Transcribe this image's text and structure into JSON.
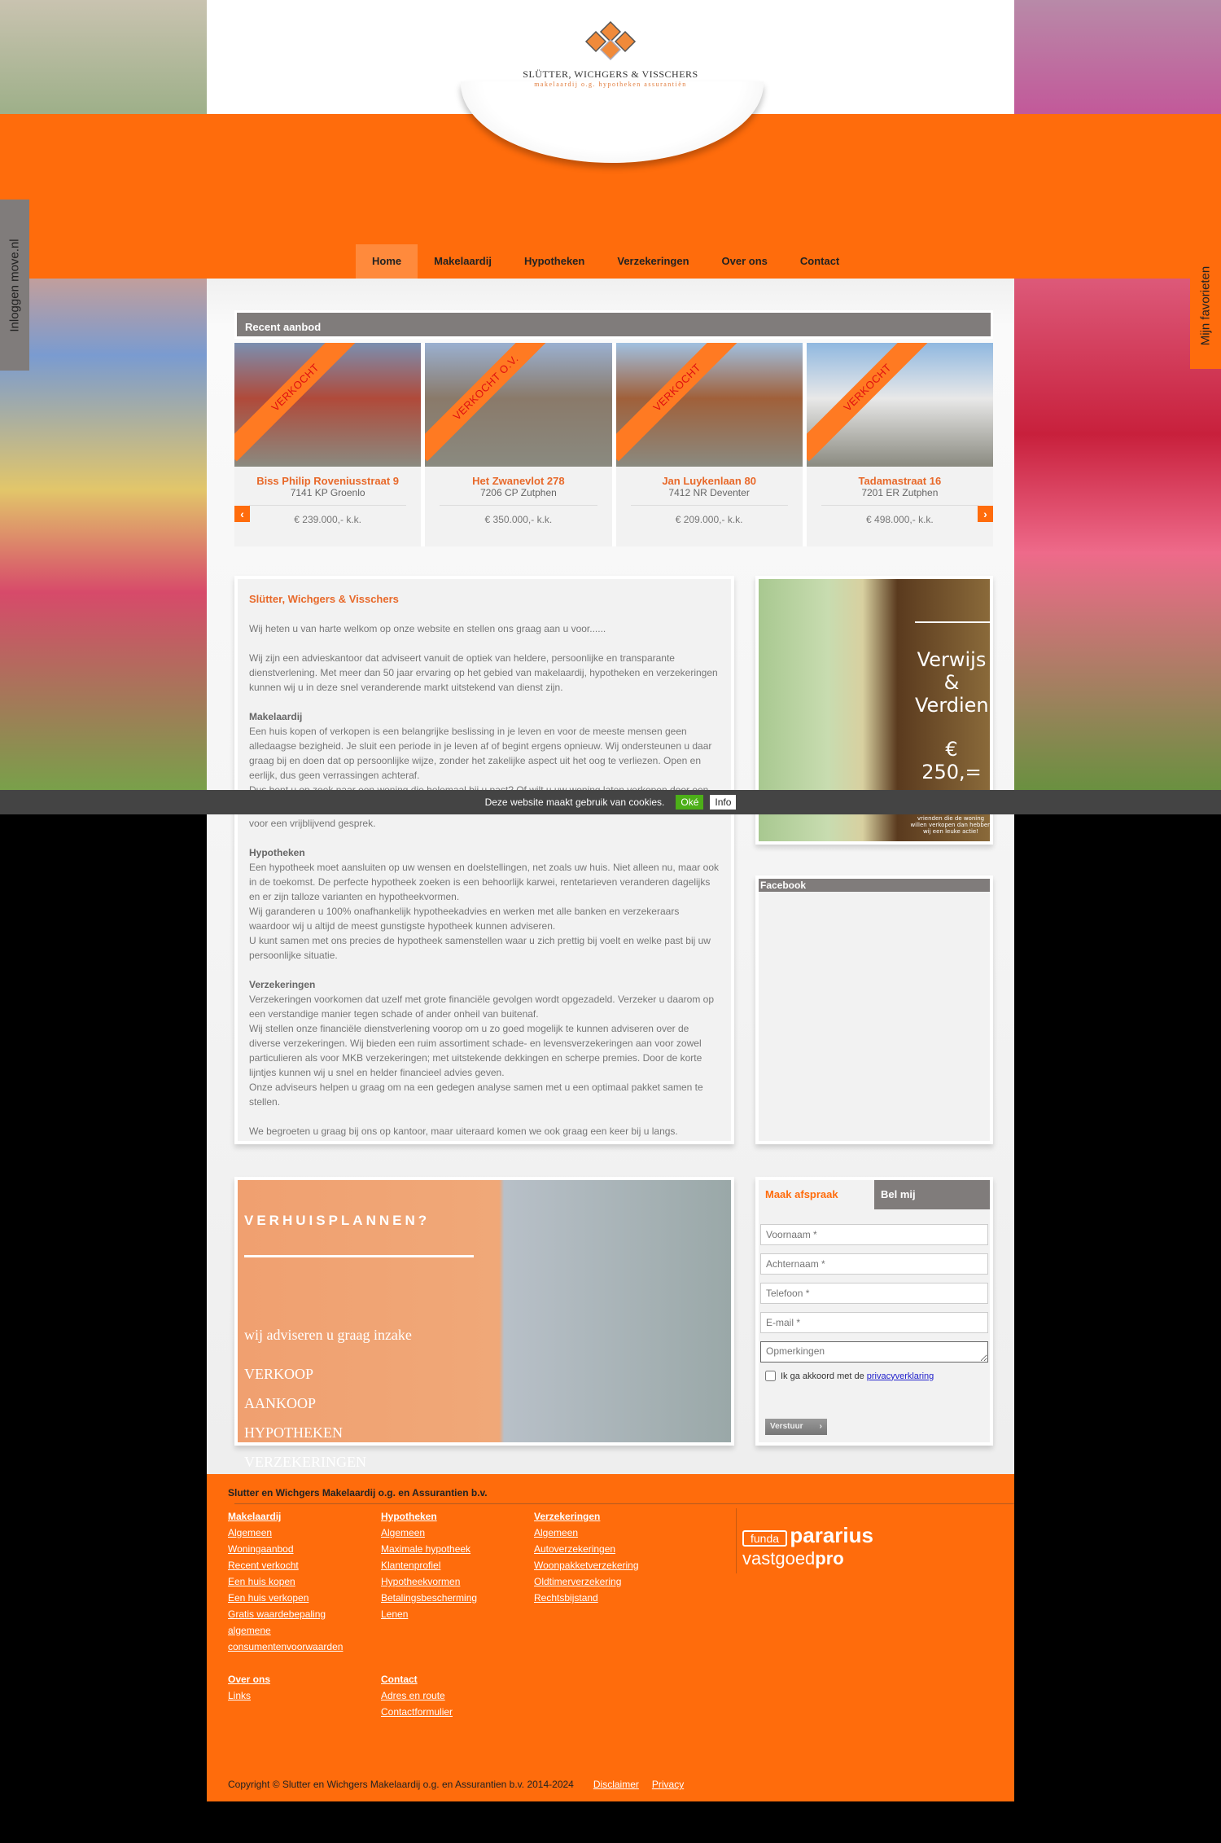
{
  "brand": {
    "title": "SLÜTTER, WICHGERS & VISSCHERS",
    "subtitle": "makelaardij o.g. hypotheken assurantiën",
    "accent": "#ff6c0c",
    "gray": "#807c7b"
  },
  "nav": [
    "Home",
    "Makelaardij",
    "Hypotheken",
    "Verzekeringen",
    "Over ons",
    "Contact"
  ],
  "side": {
    "login": "Inloggen move.nl",
    "favorites": "Mijn favorieten"
  },
  "recent": {
    "title": "Recent aanbod",
    "items": [
      {
        "badge": "VERKOCHT",
        "street": "Biss Philip Roveniusstraat 9",
        "city": "7141 KP Groenlo",
        "price": "€ 239.000,- k.k."
      },
      {
        "badge": "VERKOCHT O.V.",
        "street": "Het Zwanevlot 278",
        "city": "7206 CP Zutphen",
        "price": "€ 350.000,- k.k."
      },
      {
        "badge": "VERKOCHT",
        "street": "Jan Luykenlaan 80",
        "city": "7412 NR Deventer",
        "price": "€ 209.000,- k.k."
      },
      {
        "badge": "VERKOCHT",
        "street": "Tadamastraat 16",
        "city": "7201 ER Zutphen",
        "price": "€ 498.000,- k.k."
      }
    ]
  },
  "intro": {
    "title": "Slütter, Wichgers & Visschers",
    "p1": "Wij heten u van harte welkom op onze website en stellen ons graag aan u voor......",
    "p2": "Wij zijn een advieskantoor dat adviseert vanuit de optiek van heldere, persoonlijke en transparante dienstverlening. Met meer dan 50 jaar ervaring op het gebied van makelaardij, hypotheken en verzekeringen kunnen wij u in deze snel veranderende markt uitstekend van dienst zijn.",
    "h_mak": "Makelaardij",
    "p_mak": "Een huis kopen of verkopen is een belangrijke beslissing in je leven en voor de meeste mensen geen alledaagse bezigheid. Je sluit een periode in je leven af of begint ergens opnieuw. Wij ondersteunen u daar graag bij en doen dat op persoonlijke wijze, zonder het zakelijke aspect uit het oog te verliezen. Open en eerlijk, dus geen verrassingen achteraf.",
    "p_mak2": "Dus bent u op zoek naar een woning die helemaal bij u past? Of wilt u uw woning laten verkopen door een",
    "p_mak3": "voor een vrijblijvend gesprek.",
    "h_hyp": "Hypotheken",
    "p_hyp": "Een hypotheek moet aansluiten op uw wensen en doelstellingen, net zoals uw huis. Niet alleen nu, maar ook in de toekomst. De perfecte hypotheek zoeken is een behoorlijk karwei, rentetarieven veranderen dagelijks en er zijn talloze varianten en hypotheekvormen.",
    "p_hyp2": "Wij garanderen u 100% onafhankelijk hypotheekadvies en werken met alle banken en verzekeraars waardoor wij u altijd de meest gunstigste hypotheek kunnen adviseren.",
    "p_hyp3": "U kunt samen met ons precies de hypotheek samenstellen waar u zich prettig bij voelt en welke past bij uw persoonlijke situatie.",
    "h_ver": "Verzekeringen",
    "p_ver": "Verzekeringen voorkomen dat uzelf met grote financiële gevolgen wordt opgezadeld. Verzeker u daarom op een verstandige manier tegen schade of ander onheil van buitenaf.",
    "p_ver2": "Wij stellen onze financiële dienstverlening voorop om u zo goed mogelijk te kunnen adviseren over de diverse verzekeringen. Wij bieden een ruim assortiment schade- en levensverzekeringen aan voor zowel particulieren als voor MKB verzekeringen; met uitstekende dekkingen en scherpe premies. Door de korte lijntjes kunnen wij u snel en helder financieel advies geven.",
    "p_ver3": "Onze adviseurs helpen u graag om na een gedegen analyse samen met u een optimaal pakket samen te stellen.",
    "p_end": "We begroeten u graag bij ons op kantoor, maar uiteraard komen we ook graag een keer bij u langs."
  },
  "verwijs": {
    "l1": "Verwijs",
    "l2": "&",
    "l3": "Verdien",
    "amount": "€ 250,=",
    "small": "vrienden die de woning willen verkopen dan hebben wij een leuke actie!"
  },
  "facebook": {
    "title": "Facebook"
  },
  "banner": {
    "title": "VERHUISPLANNEN?",
    "lead": "wij adviseren u graag inzake",
    "items": [
      "VERKOOP",
      "AANKOOP",
      "HYPOTHEKEN",
      "VERZEKERINGEN"
    ]
  },
  "form": {
    "tab1": "Maak afspraak",
    "tab2": "Bel mij",
    "fields": [
      "Voornaam *",
      "Achternaam *",
      "Telefoon *",
      "E-mail *"
    ],
    "remarks": "Opmerkingen",
    "agree": "Ik ga akkoord met de ",
    "privacy": "privacyverklaring",
    "submit": "Verstuur"
  },
  "footer": {
    "company": "Slutter en Wichgers Makelaardij o.g. en Assurantien b.v.",
    "cols": [
      {
        "head": "Makelaardij",
        "links": [
          "Algemeen",
          "Woningaanbod",
          "Recent verkocht",
          "Een huis kopen",
          "Een huis verkopen",
          "Gratis waardebepaling",
          "algemene",
          "consumentenvoorwaarden"
        ]
      },
      {
        "head": "Hypotheken",
        "links": [
          "Algemeen",
          "Maximale hypotheek",
          "Klantenprofiel",
          "Hypotheekvormen",
          "Betalingsbescherming",
          "Lenen"
        ]
      },
      {
        "head": "Verzekeringen",
        "links": [
          "Algemeen",
          "Autoverzekeringen",
          "Woonpakketverzekering",
          "Oldtimerverzekering",
          "Rechtsbijstand"
        ]
      },
      {
        "head": "Over ons",
        "links": [
          "Links"
        ]
      },
      {
        "head": "Contact",
        "links": [
          "Adres en route",
          "Contactformulier"
        ]
      }
    ],
    "logos": {
      "funda": "funda",
      "pararius": "pararius",
      "vastgoed": "vastgoed",
      "pro": "pro"
    },
    "copyright": "Copyright © Slutter en Wichgers Makelaardij o.g. en Assurantien b.v. 2014-2024",
    "disclaimer": "Disclaimer",
    "privacy": "Privacy"
  },
  "cookie": {
    "text": "Deze website maakt gebruik van cookies.",
    "ok": "Oké",
    "info": "Info"
  }
}
